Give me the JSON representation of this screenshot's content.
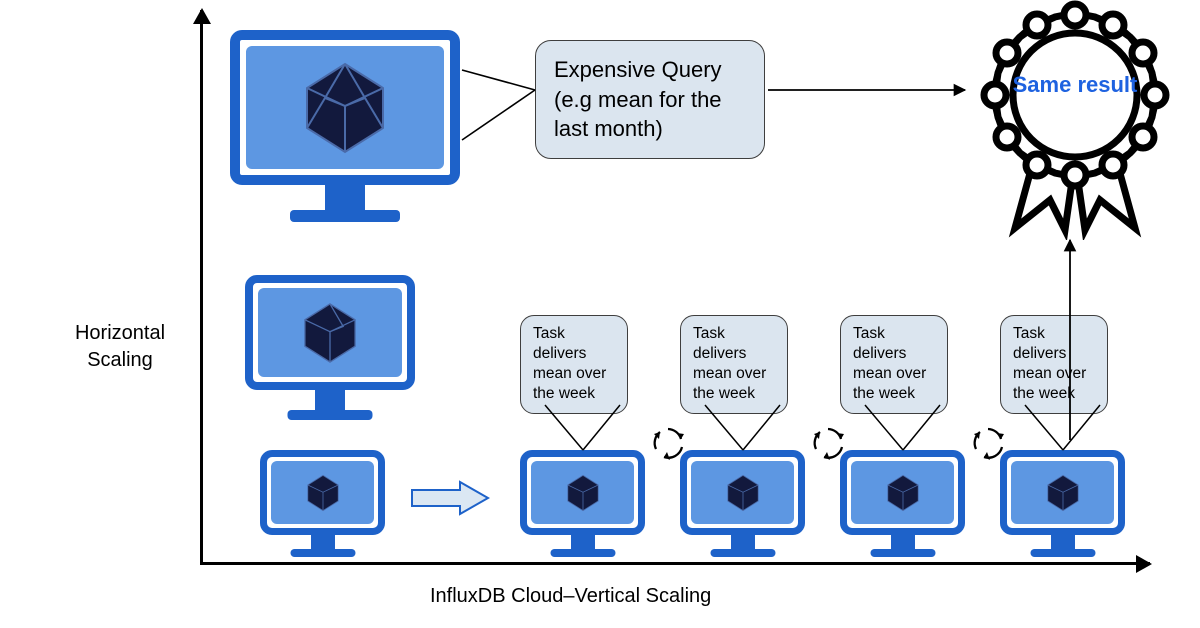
{
  "axes": {
    "y_label": "Horizontal Scaling",
    "x_label": "InfluxDB Cloud–Vertical Scaling"
  },
  "callouts": {
    "expensive_query": "Expensive Query (e.g mean for the last month)",
    "task1": "Task delivers mean over the week",
    "task2": "Task delivers mean over the week",
    "task3": "Task delivers mean over the week",
    "task4": "Task delivers mean over the week"
  },
  "ribbon": {
    "text": "Same result"
  }
}
